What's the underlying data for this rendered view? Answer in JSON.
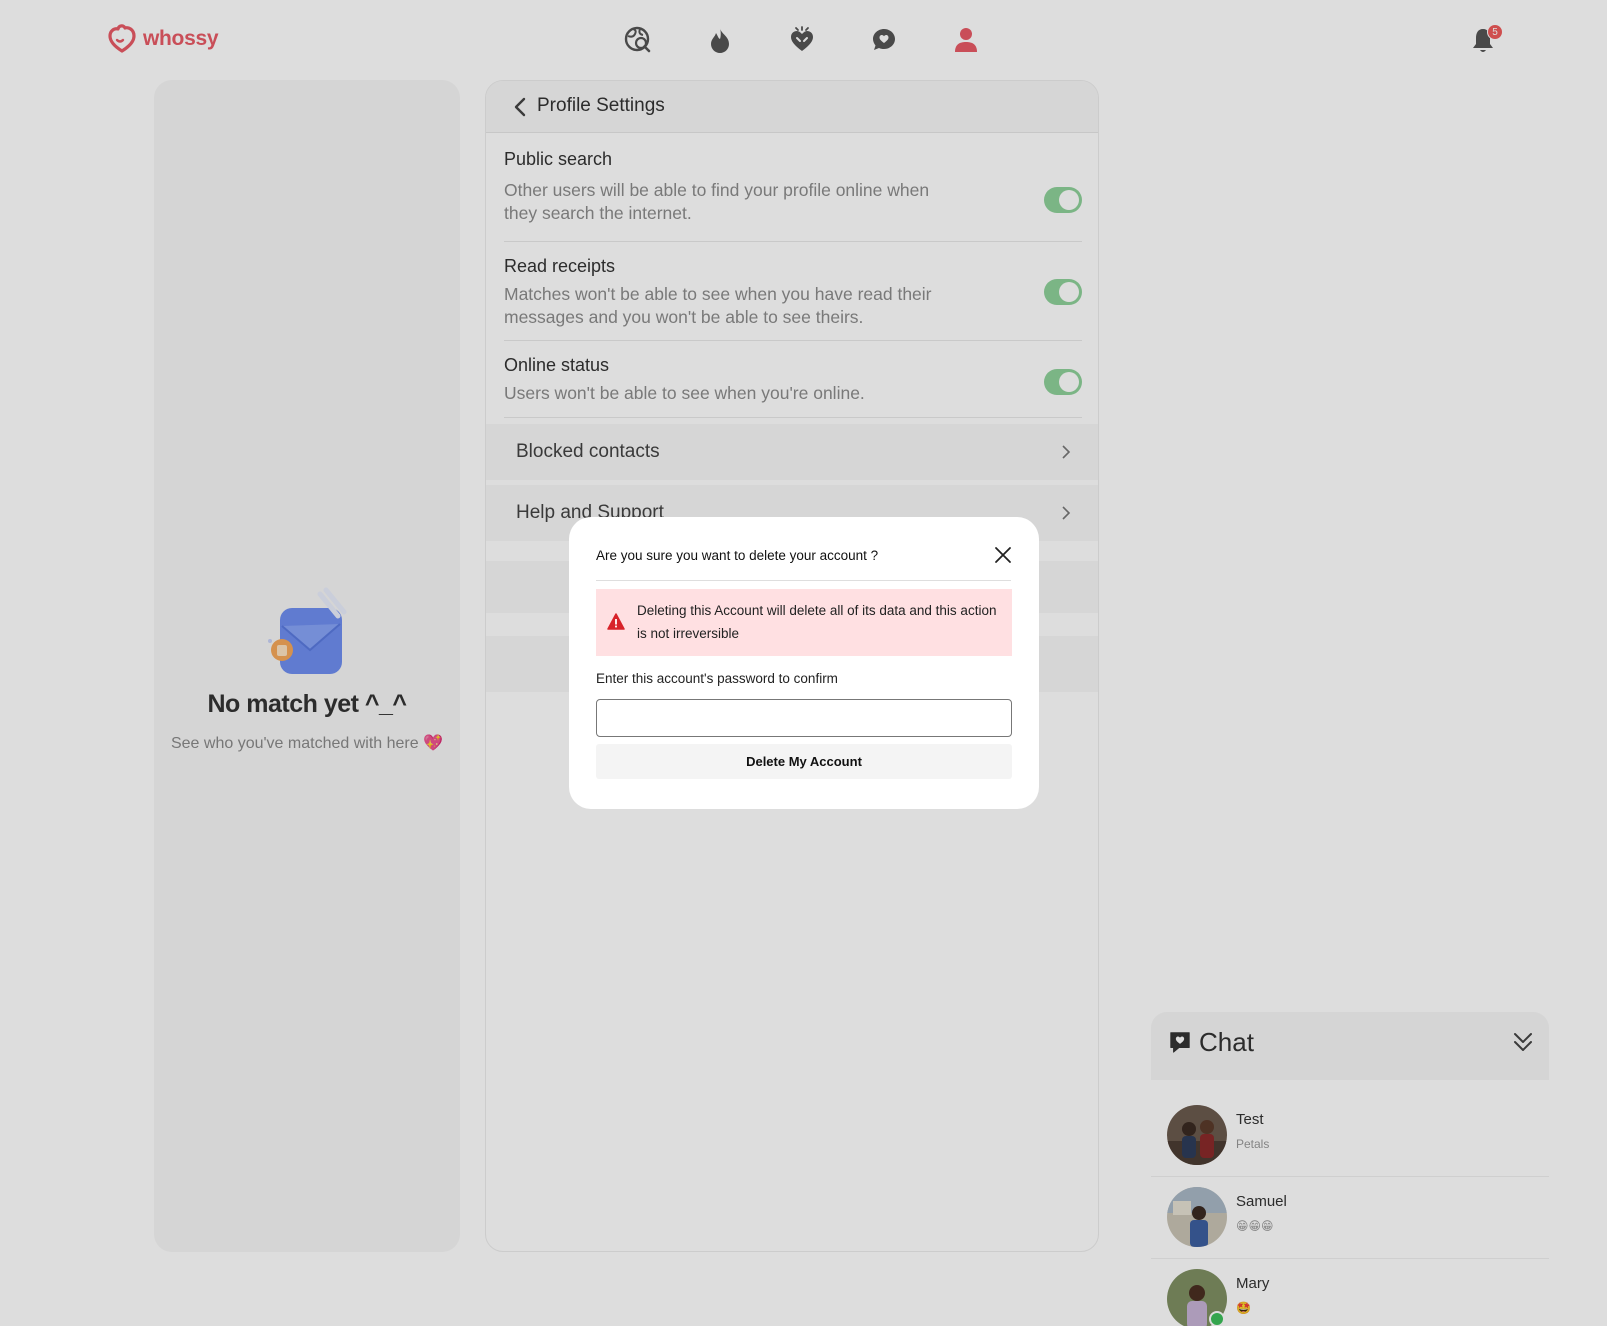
{
  "app": {
    "brand": "whossy"
  },
  "nav": {
    "items": [
      {
        "name": "explore",
        "icon": "globe-search-icon",
        "active": false
      },
      {
        "name": "matches",
        "icon": "flame-icon",
        "active": false
      },
      {
        "name": "likes",
        "icon": "heart-hands-icon",
        "active": false
      },
      {
        "name": "messages",
        "icon": "chat-heart-icon",
        "active": false
      },
      {
        "name": "profile",
        "icon": "user-icon",
        "active": true
      }
    ],
    "notifications": {
      "icon": "bell-icon",
      "count": "5"
    }
  },
  "matches_panel": {
    "empty_title": "No match yet ^_^",
    "empty_subtitle": "See who you've matched with here 💖"
  },
  "settings": {
    "title": "Profile Settings",
    "toggles": [
      {
        "title": "Public search",
        "description": "Other users will be able to find your profile online when they search the internet.",
        "enabled": true
      },
      {
        "title": "Read receipts",
        "description": "Matches won't be able to see when you have read their messages and you won't be able to see theirs.",
        "enabled": true
      },
      {
        "title": "Online status",
        "description": "Users won't be able to see when you're online.",
        "enabled": true
      }
    ],
    "links": [
      {
        "label": "Blocked contacts"
      },
      {
        "label": "Help and Support"
      }
    ]
  },
  "chat": {
    "title": "Chat",
    "items": [
      {
        "name": "Test",
        "preview": "Petals",
        "online": false
      },
      {
        "name": "Samuel",
        "preview": "😁😁😁",
        "online": false
      },
      {
        "name": "Mary",
        "preview": "🤩",
        "online": true
      }
    ]
  },
  "modal": {
    "title": "Are you sure you want to delete your account ?",
    "alert_text": "Deleting this Account will delete all of its data and this action is not irreversible",
    "password_label": "Enter this account's password to confirm",
    "password_value": "",
    "delete_button": "Delete My Account"
  },
  "colors": {
    "brand": "#e85a66",
    "toggle_on": "#8ed19a",
    "alert_bg": "#ffe0e2",
    "alert_icon": "#d8232a"
  }
}
